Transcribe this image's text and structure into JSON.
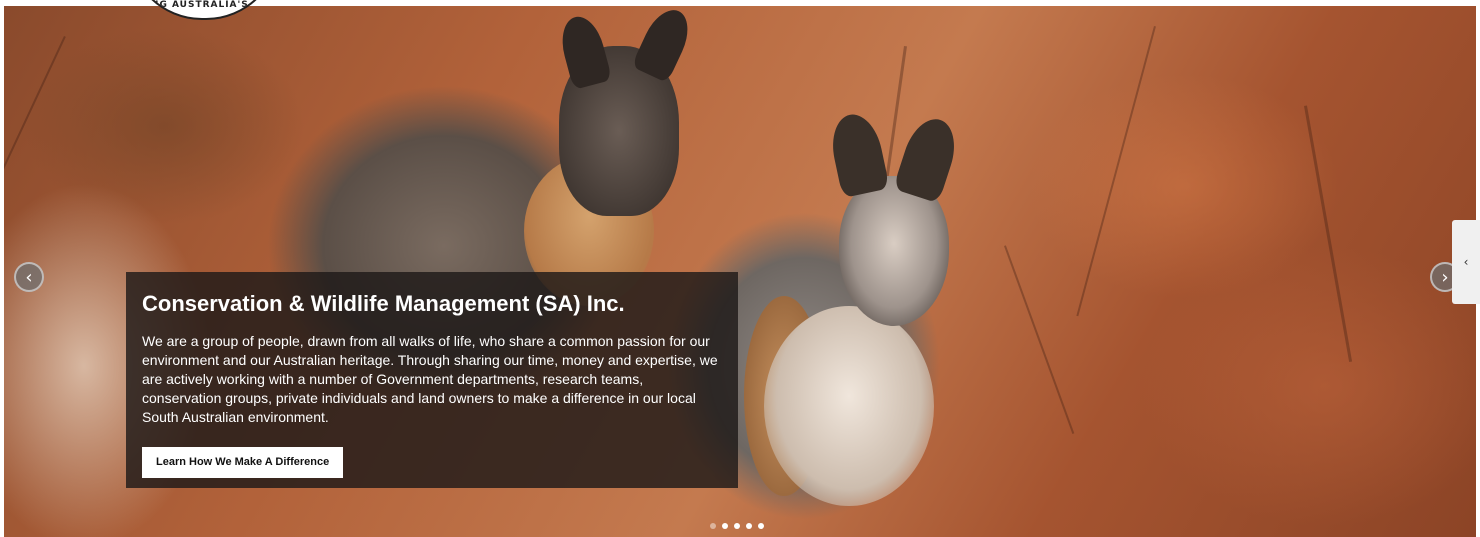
{
  "logo": {
    "text": "ING AUSTRALIA'S H"
  },
  "slide": {
    "title": "Conservation & Wildlife Management (SA) Inc.",
    "body": "We are a group of people, drawn from all walks of life, who share a common passion for our environment and our Australian heritage. Through sharing our time, money and expertise, we are actively working with a number of Government departments, research teams, conservation groups, private individuals and land owners to make a difference in our local South Australian environment.",
    "cta_label": "Learn How We Make A Difference"
  },
  "controls": {
    "prev_icon": "chevron-left-icon",
    "next_icon": "chevron-right-icon",
    "side_tab_icon": "chevron-left-icon",
    "prev_glyph": "‹",
    "next_glyph": "›",
    "side_glyph": "‹",
    "dots_count": 5,
    "active_dot": 1
  }
}
